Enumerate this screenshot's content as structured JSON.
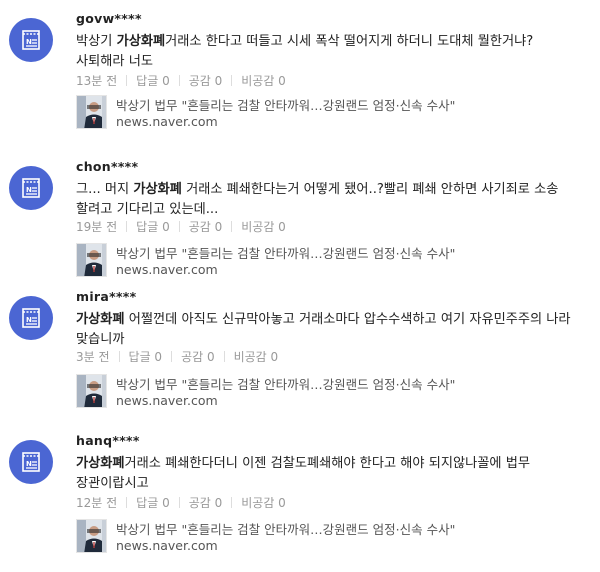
{
  "comments": [
    {
      "username": "govw****",
      "keyword": "가상화폐",
      "pre_text": "박상기 ",
      "post_text": "거래소 한다고 떠들고 시세 폭삭 떨어지게 하더니 도대체 뭘한거냐? 사퇴해라 너도",
      "time": "13분 전",
      "reply_label": "답글 0",
      "like_label": "공감 0",
      "dislike_label": "비공감 0",
      "article_title": "박상기 법무 \"흔들리는 검찰 안타까워…강원랜드 엄정·신속 수사\"",
      "article_domain": "news.naver.com"
    },
    {
      "username": "chon****",
      "keyword": "가상화폐",
      "pre_text": "그... 머지 ",
      "post_text": " 거래소 폐쇄한다는거 어떻게 됐어..?빨리 폐쇄 안하면 사기죄로 소송 할려고 기다리고 있는데...",
      "time": "19분 전",
      "reply_label": "답글 0",
      "like_label": "공감 0",
      "dislike_label": "비공감 0",
      "article_title": "박상기 법무 \"흔들리는 검찰 안타까워…강원랜드 엄정·신속 수사\"",
      "article_domain": "news.naver.com"
    },
    {
      "username": "mira****",
      "keyword": "가상화폐",
      "pre_text": "",
      "post_text": " 어쩔껀데 아직도 신규막아놓고 거래소마다 압수수색하고 여기 자유민주주의 나라 맞습니까",
      "time": "3분 전",
      "reply_label": "답글 0",
      "like_label": "공감 0",
      "dislike_label": "비공감 0",
      "article_title": "박상기 법무 \"흔들리는 검찰 안타까워…강원랜드 엄정·신속 수사\"",
      "article_domain": "news.naver.com"
    },
    {
      "username": "hanq****",
      "keyword": "가상화폐",
      "pre_text": "",
      "post_text": "거래소 폐쇄한다더니 이젠 검찰도폐쇄해야 한다고 해야 되지않나꼴에 법무 장관이랍시고",
      "time": "12분 전",
      "reply_label": "답글 0",
      "like_label": "공감 0",
      "dislike_label": "비공감 0",
      "article_title": "박상기 법무 \"흔들리는 검찰 안타까워…강원랜드 엄정·신속 수사\"",
      "article_domain": "news.naver.com"
    }
  ],
  "colors": {
    "avatar_bg": "#4b66d3",
    "meta_text": "#999999",
    "body_text": "#222222"
  },
  "icons": {
    "avatar": "news-document-icon",
    "thumbnail": "article-thumbnail"
  }
}
